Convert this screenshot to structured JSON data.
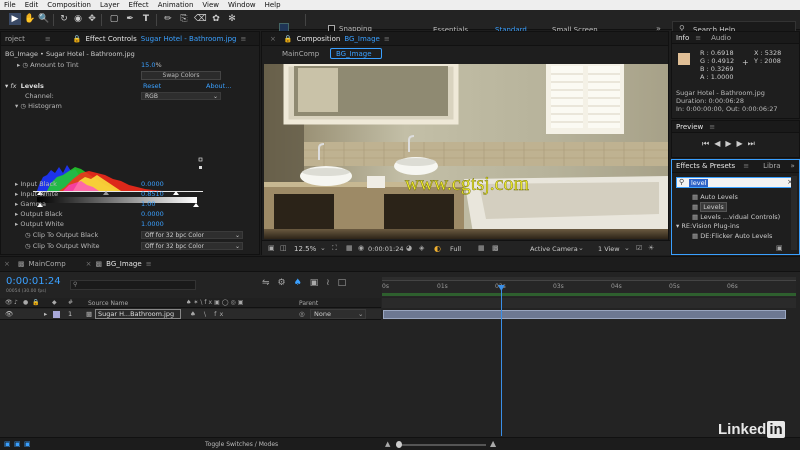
{
  "menu": [
    "File",
    "Edit",
    "Composition",
    "Layer",
    "Effect",
    "Animation",
    "View",
    "Window",
    "Help"
  ],
  "toolbar": {
    "snapping": "Snapping",
    "workspaces": [
      "Essentials",
      "Standard",
      "Small Screen"
    ],
    "search_placeholder": "Search Help"
  },
  "project_tab": "roject",
  "effect_controls": {
    "tab_label": "Effect Controls",
    "tab_layer": "Sugar Hotel - Bathroom.jpg",
    "breadcrumb": "BG_Image • Sugar Hotel - Bathroom.jpg",
    "amount_to_tint_label": "Amount to Tint",
    "amount_to_tint_value": "15.0",
    "amount_to_tint_unit": "%",
    "swap_colors": "Swap Colors",
    "fx_badge": "fx",
    "effect_name": "Levels",
    "reset": "Reset",
    "about": "About...",
    "channel_label": "Channel:",
    "channel_value": "RGB",
    "histogram_label": "Histogram",
    "params": [
      {
        "label": "Input Black",
        "value": "0.0000"
      },
      {
        "label": "Input White",
        "value": "0.8510"
      },
      {
        "label": "Gamma",
        "value": "1.00"
      },
      {
        "label": "Output Black",
        "value": "0.0000"
      },
      {
        "label": "Output White",
        "value": "1.0000"
      }
    ],
    "clip_black_label": "Clip To Output Black",
    "clip_black_value": "Off for 32 bpc Color",
    "clip_white_label": "Clip To Output White",
    "clip_white_value": "Off for 32 bpc Color"
  },
  "composition": {
    "tab_label": "Composition",
    "tab_comp": "BG_Image",
    "breadcrumbs": [
      "MainComp",
      "BG_Image"
    ],
    "watermark": "www.cgtsj.com",
    "zoom": "12.5%",
    "timecode": "0:00:01:24",
    "resolution": "Full",
    "camera": "Active Camera",
    "views": "1 View"
  },
  "info": {
    "tabs": [
      "Info",
      "Audio"
    ],
    "r": "R : 0.6918",
    "g": "G : 0.4912",
    "b": "B : 0.3269",
    "a": "A : 1.0000",
    "x": "X : 5328",
    "y": "Y : 2008",
    "plus": "+",
    "layer_name": "Sugar Hotel - Bathroom.jpg",
    "duration": "Duration: 0:00:06:28",
    "in_out": "In: 0:00:00:00, Out: 0:00:06:27",
    "swatch_color": "#e0bf96"
  },
  "preview": {
    "label": "Preview"
  },
  "effects_presets": {
    "tab_label": "Effects & Presets",
    "tab_other": "Libra",
    "search_value": "level",
    "items": [
      {
        "label": "Auto Levels",
        "selected": false
      },
      {
        "label": "Levels",
        "selected": true
      },
      {
        "label": "Levels ...vidual Controls)",
        "selected": false
      }
    ],
    "category": "RE:Vision Plug-ins",
    "category_item": "DE:Flicker Auto Levels"
  },
  "timeline": {
    "tabs": [
      "MainComp",
      "BG_Image"
    ],
    "timecode": "0:00:01:24",
    "timecode_sub": "00054 (30.00 fps)",
    "col_source": "Source Name",
    "col_parent": "Parent",
    "layer_index": "1",
    "layer_name": "Sugar H...Bathroom.jpg",
    "layer_parent": "None",
    "ruler": [
      "0s",
      "01s",
      "02s",
      "03s",
      "04s",
      "05s",
      "06s"
    ],
    "toggle": "Toggle Switches / Modes",
    "playhead_fraction": 0.287
  },
  "branding": {
    "text": "Linked",
    "in": "in"
  }
}
